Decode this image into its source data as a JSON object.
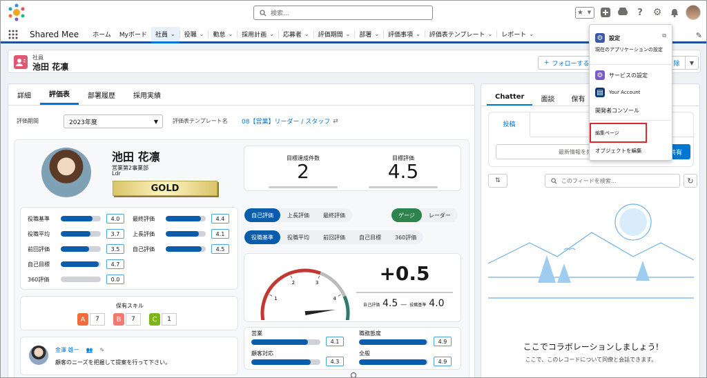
{
  "header": {
    "search_placeholder": "検索..."
  },
  "nav": {
    "app_name": "Shared Mee",
    "items": [
      {
        "label": "ホーム",
        "chevron": false
      },
      {
        "label": "Myボード",
        "chevron": false
      },
      {
        "label": "社員",
        "chevron": true,
        "active": true
      },
      {
        "label": "役職",
        "chevron": true
      },
      {
        "label": "勤怠",
        "chevron": true
      },
      {
        "label": "採用計画",
        "chevron": true
      },
      {
        "label": "応募者",
        "chevron": true
      },
      {
        "label": "評価期間",
        "chevron": true
      },
      {
        "label": "部署",
        "chevron": true
      },
      {
        "label": "評価事項",
        "chevron": true
      },
      {
        "label": "評価表テンプレート",
        "chevron": true
      },
      {
        "label": "レポート",
        "chevron": true
      }
    ]
  },
  "record": {
    "type": "社員",
    "name": "池田 花凛",
    "follow_label": "フォローする",
    "delete_label": "除"
  },
  "tabs": [
    "詳細",
    "評価表",
    "部署履歴",
    "採用実績"
  ],
  "form": {
    "period_label": "評価期間",
    "period_value": "2023年度",
    "template_label": "評価表テンプレート名",
    "template_value": "08【営業】リーダー / スタッフ"
  },
  "profile": {
    "name": "池田 花凛",
    "dept": "営業第2事業部",
    "role": "Ldr",
    "rank": "GOLD"
  },
  "kpis": {
    "achievement_label": "目標達成件数",
    "achievement_value": "2",
    "score_label": "目標評価",
    "score_value": "4.5"
  },
  "metrics_left": [
    {
      "label": "役職基準",
      "value": "4.0",
      "fill": 0.8
    },
    {
      "label": "役職平均",
      "value": "3.7",
      "fill": 0.74
    },
    {
      "label": "前回評価",
      "value": "3.5",
      "fill": 0.7
    },
    {
      "label": "自己目標",
      "value": "4.7",
      "fill": 0.94
    },
    {
      "label": "360評価",
      "value": "0.0",
      "fill": 0
    }
  ],
  "metrics_right": [
    {
      "label": "最終評価",
      "value": "4.4",
      "fill": 0.88
    },
    {
      "label": "上長評価",
      "value": "4.1",
      "fill": 0.82
    },
    {
      "label": "自己評価",
      "value": "4.5",
      "fill": 0.9
    }
  ],
  "skills": {
    "title": "保有スキル",
    "items": [
      {
        "grade": "A",
        "count": "7",
        "color": "#f26b3a"
      },
      {
        "grade": "B",
        "count": "7",
        "color": "#f3786e"
      },
      {
        "grade": "C",
        "count": "1",
        "color": "#7cb518"
      }
    ]
  },
  "comment": {
    "author": "金澤 雄一",
    "text": "顧客のニーズを把握して提案を行って下さい。"
  },
  "toggles": {
    "group1": [
      "自己評価",
      "上長評価",
      "最終評価"
    ],
    "group2": [
      "ゲージ",
      "レーダー"
    ],
    "group3": [
      "役職基準",
      "役職平均",
      "前回評価",
      "自己目標",
      "360評価"
    ]
  },
  "gauge": {
    "ticks": [
      "0",
      "1",
      "2",
      "3",
      "4",
      "5"
    ],
    "diff": "+0.5",
    "self_label": "自己評価",
    "self_value": "4.5",
    "dash": "—",
    "base_label": "役職基準",
    "base_value": "4.0",
    "needle_value": 4.5
  },
  "bars": [
    {
      "label": "営業",
      "value": "4.1",
      "fill": 0.82
    },
    {
      "label": "顧客対応",
      "value": "4.3",
      "fill": 0.86
    },
    {
      "label": "職務態度",
      "value": "4.9",
      "fill": 0.98
    },
    {
      "label": "全般",
      "value": "4.9",
      "fill": 0.98
    }
  ],
  "chatter": {
    "tabs": [
      "Chatter",
      "面談",
      "保有"
    ],
    "post_tab": "投稿",
    "share_placeholder": "最新情報を共",
    "share_button": "共有",
    "sort_label": "⇅",
    "feed_search_placeholder": "このフィードを検索...",
    "empty_title": "ここでコラボレーションしましょう!",
    "empty_text": "ここで、このレコードについて同僚と会話できます。"
  },
  "menu": {
    "setup": "設定",
    "setup_sub": "現在のアプリケーションの設定",
    "service_setup": "サービスの設定",
    "your_account": "Your Account",
    "dev_console": "開発者コンソール",
    "edit_page": "編集ページ",
    "edit_object": "オブジェクトを編集"
  }
}
